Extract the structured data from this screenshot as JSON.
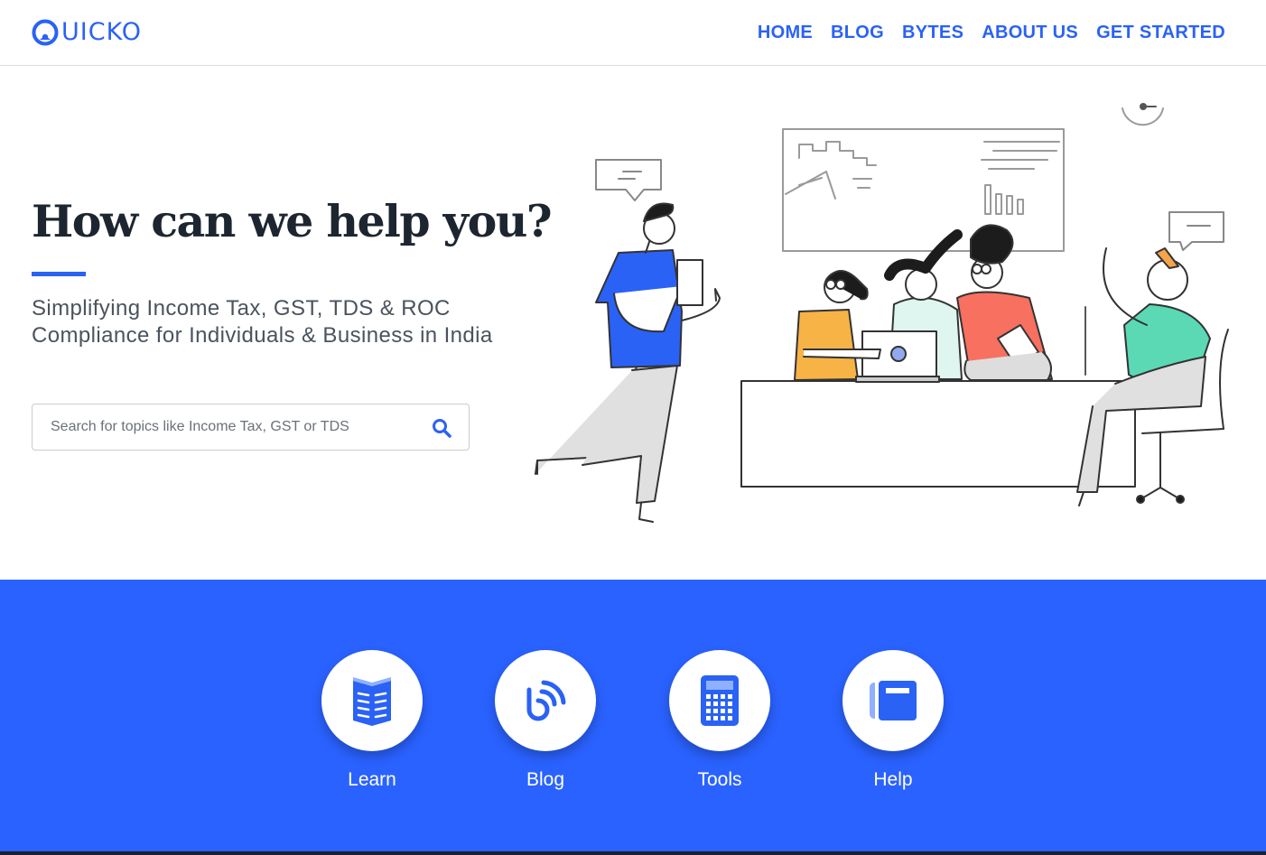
{
  "brand": {
    "name": "UICKO",
    "accent": "#2a62f5",
    "band_color": "#2a62ff",
    "heading_color": "#1d2630"
  },
  "nav": {
    "items": [
      {
        "label": "HOME"
      },
      {
        "label": "BLOG"
      },
      {
        "label": "BYTES"
      },
      {
        "label": "ABOUT US"
      },
      {
        "label": "GET STARTED"
      }
    ]
  },
  "hero": {
    "title": "How can we help you?",
    "subtitle": "Simplifying Income Tax, GST, TDS & ROC Compliance for Individuals & Business in India",
    "search": {
      "placeholder": "Search for topics like Income Tax, GST or TDS",
      "value": "",
      "icon": "search-icon"
    },
    "illustration": "office-team-illustration"
  },
  "categories": [
    {
      "label": "Learn",
      "icon": "book-icon"
    },
    {
      "label": "Blog",
      "icon": "blog-feed-icon"
    },
    {
      "label": "Tools",
      "icon": "calculator-icon"
    },
    {
      "label": "Help",
      "icon": "help-notebook-icon"
    }
  ]
}
